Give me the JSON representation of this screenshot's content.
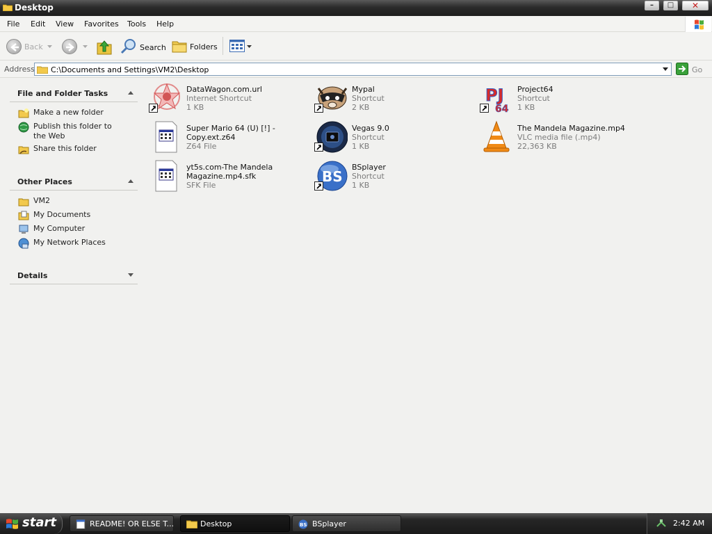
{
  "window": {
    "title": "Desktop"
  },
  "menu": [
    "File",
    "Edit",
    "View",
    "Favorites",
    "Tools",
    "Help"
  ],
  "toolbar": {
    "back": "Back",
    "search": "Search",
    "folders": "Folders"
  },
  "address": {
    "label": "Address",
    "path": "C:\\Documents and Settings\\VM2\\Desktop",
    "go": "Go"
  },
  "left_pane": {
    "file_tasks": {
      "title": "File and Folder Tasks",
      "items": [
        "Make a new folder",
        "Publish this folder to the Web",
        "Share this folder"
      ]
    },
    "other_places": {
      "title": "Other Places",
      "items": [
        "VM2",
        "My Documents",
        "My Computer",
        "My Network Places"
      ]
    },
    "details": {
      "title": "Details"
    }
  },
  "files": [
    {
      "name": "DataWagon.com.url",
      "type": "Internet Shortcut",
      "size": "1 KB",
      "icon": "datawagon-icon"
    },
    {
      "name": "Mypal",
      "type": "Shortcut",
      "size": "2 KB",
      "icon": "mypal-icon"
    },
    {
      "name": "Project64",
      "type": "Shortcut",
      "size": "1 KB",
      "icon": "project64-icon"
    },
    {
      "name": "Super Mario 64 (U) [!] - Copy.ext.z64",
      "type": "Z64 File",
      "size": "",
      "icon": "generic-file-icon"
    },
    {
      "name": "Vegas 9.0",
      "type": "Shortcut",
      "size": "1 KB",
      "icon": "vegas-icon"
    },
    {
      "name": "The Mandela Magazine.mp4",
      "type": "VLC media file (.mp4)",
      "size": "22,363 KB",
      "icon": "vlc-icon"
    },
    {
      "name": "yt5s.com-The Mandela Magazine.mp4.sfk",
      "type": "SFK File",
      "size": "",
      "icon": "generic-file-icon"
    },
    {
      "name": "BSplayer",
      "type": "Shortcut",
      "size": "1 KB",
      "icon": "bsplayer-icon"
    }
  ],
  "taskbar": {
    "start": "start",
    "buttons": [
      "README! OR ELSE T...",
      "Desktop",
      "BSplayer"
    ],
    "clock": "2:42 AM"
  },
  "colors": {
    "taskbar": "#1d1d1d",
    "background": "#f1f1ef",
    "address_border": "#7f9db9"
  }
}
